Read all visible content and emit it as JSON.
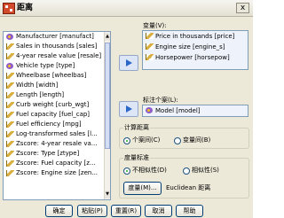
{
  "window": {
    "title": "距离",
    "close_glyph": "x"
  },
  "source_variables": {
    "items": [
      {
        "label": "Manufacturer [manufact]",
        "icon": "nominal-icon"
      },
      {
        "label": "Sales in thousands [sales]",
        "icon": "scale-icon"
      },
      {
        "label": "4-year resale value [resale]",
        "icon": "scale-icon"
      },
      {
        "label": "Vehicle type [type]",
        "icon": "nominal-icon"
      },
      {
        "label": "Wheelbase [wheelbas]",
        "icon": "scale-icon"
      },
      {
        "label": "Width [width]",
        "icon": "scale-icon"
      },
      {
        "label": "Length [length]",
        "icon": "scale-icon"
      },
      {
        "label": "Curb weight [curb_wgt]",
        "icon": "scale-icon"
      },
      {
        "label": "Fuel capacity [fuel_cap]",
        "icon": "scale-icon"
      },
      {
        "label": "Fuel efficiency [mpg]",
        "icon": "scale-icon"
      },
      {
        "label": "Log-transformed sales [l...",
        "icon": "scale-icon"
      },
      {
        "label": "Zscore:  4-year resale va...",
        "icon": "scale-icon"
      },
      {
        "label": "Zscore:  Type [ztype]",
        "icon": "scale-icon"
      },
      {
        "label": "Zscore:  Fuel capacity [z...",
        "icon": "scale-icon"
      },
      {
        "label": "Zscore:  Engine size [zen...",
        "icon": "scale-icon"
      }
    ]
  },
  "variables": {
    "label": "变量(V):",
    "items": [
      {
        "label": "Price in thousands [price]"
      },
      {
        "label": "Engine size [engine_s]"
      },
      {
        "label": "Horsepower [horsepow]"
      }
    ]
  },
  "label_cases": {
    "label": "标注个案(L):",
    "value": "Model [model]"
  },
  "calculate_distance": {
    "label": "计算距离",
    "options": [
      {
        "label": "个案间(C)",
        "selected": true
      },
      {
        "label": "变量间(B)",
        "selected": false
      }
    ]
  },
  "measure": {
    "label": "度量标准",
    "options": [
      {
        "label": "不相似性(D)",
        "selected": true
      },
      {
        "label": "相似性(S)",
        "selected": false
      }
    ],
    "button_label": "度量(M)...",
    "current": "Euclidean 距离"
  },
  "buttons": {
    "ok": "确定",
    "paste": "粘贴(P)",
    "reset": "重置(R)",
    "cancel": "取消",
    "help": "帮助"
  },
  "colors": {
    "selection": "#EEF3FB",
    "arrow": "#2A67C8",
    "window_bg": "#ECE9D8"
  }
}
